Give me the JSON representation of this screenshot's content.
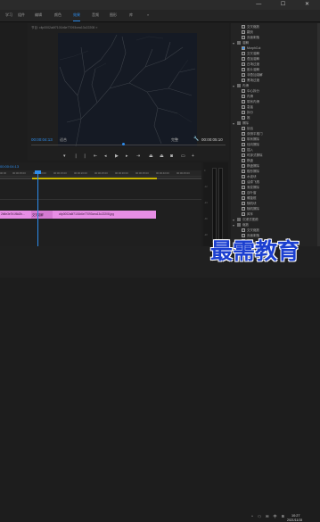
{
  "menu": {
    "tabs": [
      {
        "label": "学习"
      },
      {
        "label": "组件"
      },
      {
        "label": "编辑"
      },
      {
        "label": "颜色"
      },
      {
        "label": "效果"
      },
      {
        "label": "音频"
      },
      {
        "label": "图形"
      },
      {
        "label": "库"
      },
      {
        "label": "»"
      }
    ],
    "active_tab": "效果"
  },
  "monitor": {
    "title": "节目: clip0002a6f7101b6e77093cea13c22208 ≡",
    "timecode_left": "00:00:04:13",
    "fit": "适合",
    "quality": "完整",
    "timecode_right": "00:00:05:10",
    "progress": 0.48
  },
  "timeline": {
    "timecode": "00:00:04:13",
    "ruler": [
      "00:00",
      "00:00:05:00",
      "00:00:10:00",
      "00:00:15:00",
      "00:00:20:00",
      "00:00:25:00",
      "00:00:30:00",
      "00:00:35:00",
      "00:00:40:00",
      "00:00:45:00"
    ],
    "clip1": "2b8e3e7b1f8d2b...",
    "clip2": "clip0002a6f7101b6e77093cea13c22208.jpg",
    "cut": "交叉溶解"
  },
  "effects_panel": {
    "items": [
      {
        "label": "交叉缩放"
      },
      {
        "label": "翻页"
      },
      {
        "label": "页面剥落"
      },
      {
        "label": "溶解"
      },
      {
        "label": "MorphCut"
      },
      {
        "label": "交叉溶解"
      },
      {
        "label": "叠加溶解"
      },
      {
        "label": "白场过渡"
      },
      {
        "label": "胶片溶解"
      },
      {
        "label": "非叠加溶解"
      },
      {
        "label": "黑场过渡"
      },
      {
        "label": "内滑"
      },
      {
        "label": "中心拆分"
      },
      {
        "label": "内滑"
      },
      {
        "label": "带状内滑"
      },
      {
        "label": "急摇"
      },
      {
        "label": "拆分"
      },
      {
        "label": "推"
      },
      {
        "label": "擦除"
      },
      {
        "label": "划出"
      },
      {
        "label": "双侧平推门"
      },
      {
        "label": "带状擦除"
      },
      {
        "label": "径向擦除"
      },
      {
        "label": "插入"
      },
      {
        "label": "时钟式擦除"
      },
      {
        "label": "棋盘"
      },
      {
        "label": "棋盘擦除"
      },
      {
        "label": "楔形擦除"
      },
      {
        "label": "水波块"
      },
      {
        "label": "油漆飞溅"
      },
      {
        "label": "渐变擦除"
      },
      {
        "label": "百叶窗"
      },
      {
        "label": "螺旋框"
      },
      {
        "label": "随机块"
      },
      {
        "label": "随机擦除"
      },
      {
        "label": "风车"
      },
      {
        "label": "沉浸式视频"
      },
      {
        "label": "缩放"
      },
      {
        "label": "交叉缩放"
      },
      {
        "label": "页面剥落"
      },
      {
        "label": "翻页"
      }
    ]
  },
  "taskbar": {
    "time": "10:27",
    "date": "2021/11/15",
    "icons": "^ ☁ ✉ 中 ⊞"
  },
  "watermark": "最需教育",
  "window_controls": "— ☐ ✕",
  "colors": {
    "accent": "#2d8ceb",
    "clip": "#e78ee5",
    "workbar": "#c9b500",
    "watermark": "#1b3fd0"
  }
}
